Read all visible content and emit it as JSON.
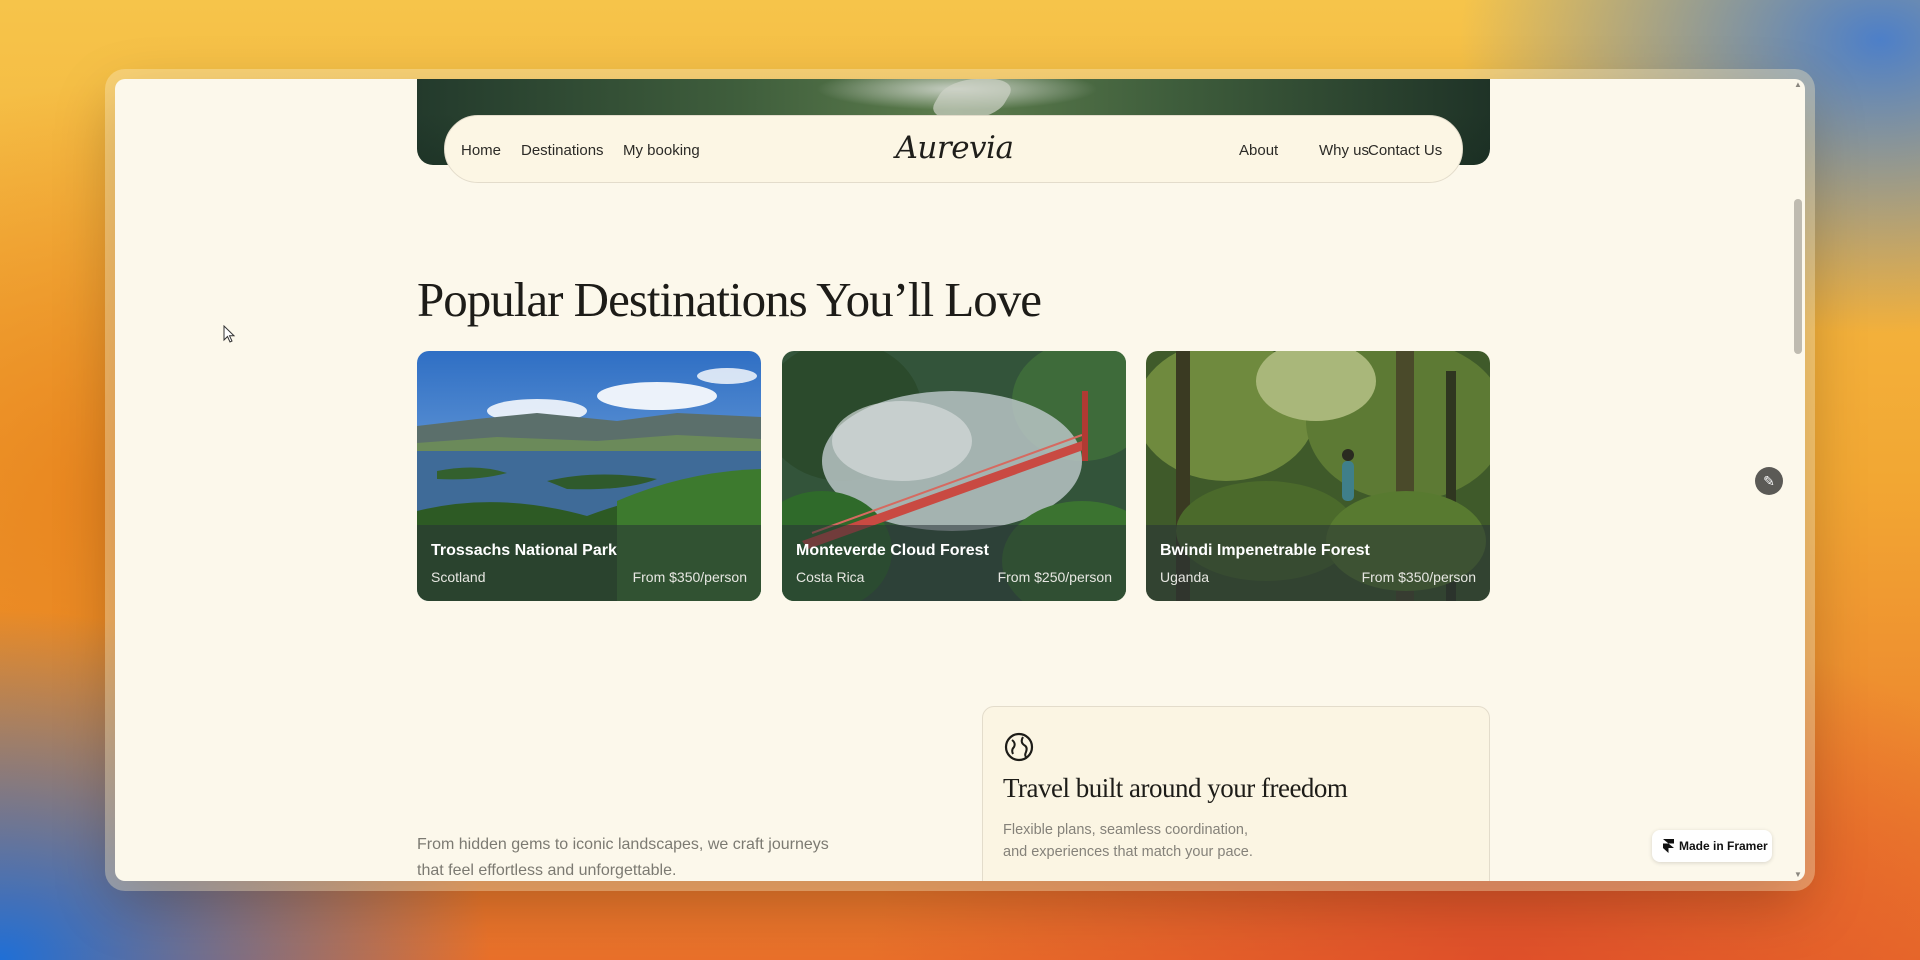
{
  "nav": {
    "left_links": [
      "Home",
      "Destinations",
      "My booking"
    ],
    "brand": "Aurevia",
    "right_links": [
      "About",
      "Why us",
      "Contact Us"
    ]
  },
  "section": {
    "title": "Popular Destinations You’ll Love"
  },
  "destinations": [
    {
      "name": "Trossachs National Park",
      "country": "Scotland",
      "price": "From $350/person"
    },
    {
      "name": "Monteverde Cloud Forest",
      "country": "Costa Rica",
      "price": "From $250/person"
    },
    {
      "name": "Bwindi Impenetrable Forest",
      "country": "Uganda",
      "price": "From $350/person"
    }
  ],
  "intro": {
    "line1": "From hidden gems to iconic landscapes, we craft journeys",
    "line2": "that feel effortless and unforgettable."
  },
  "feature": {
    "icon": "globe-icon",
    "title": "Travel built around your freedom",
    "line1": "Flexible plans, seamless coordination,",
    "line2": "and experiences that match your pace."
  },
  "badge": {
    "label": "Made in Framer"
  },
  "colors": {
    "page_bg": "#fcf8eb",
    "text_dark": "#1d1c18",
    "muted": "#7c7a72"
  }
}
